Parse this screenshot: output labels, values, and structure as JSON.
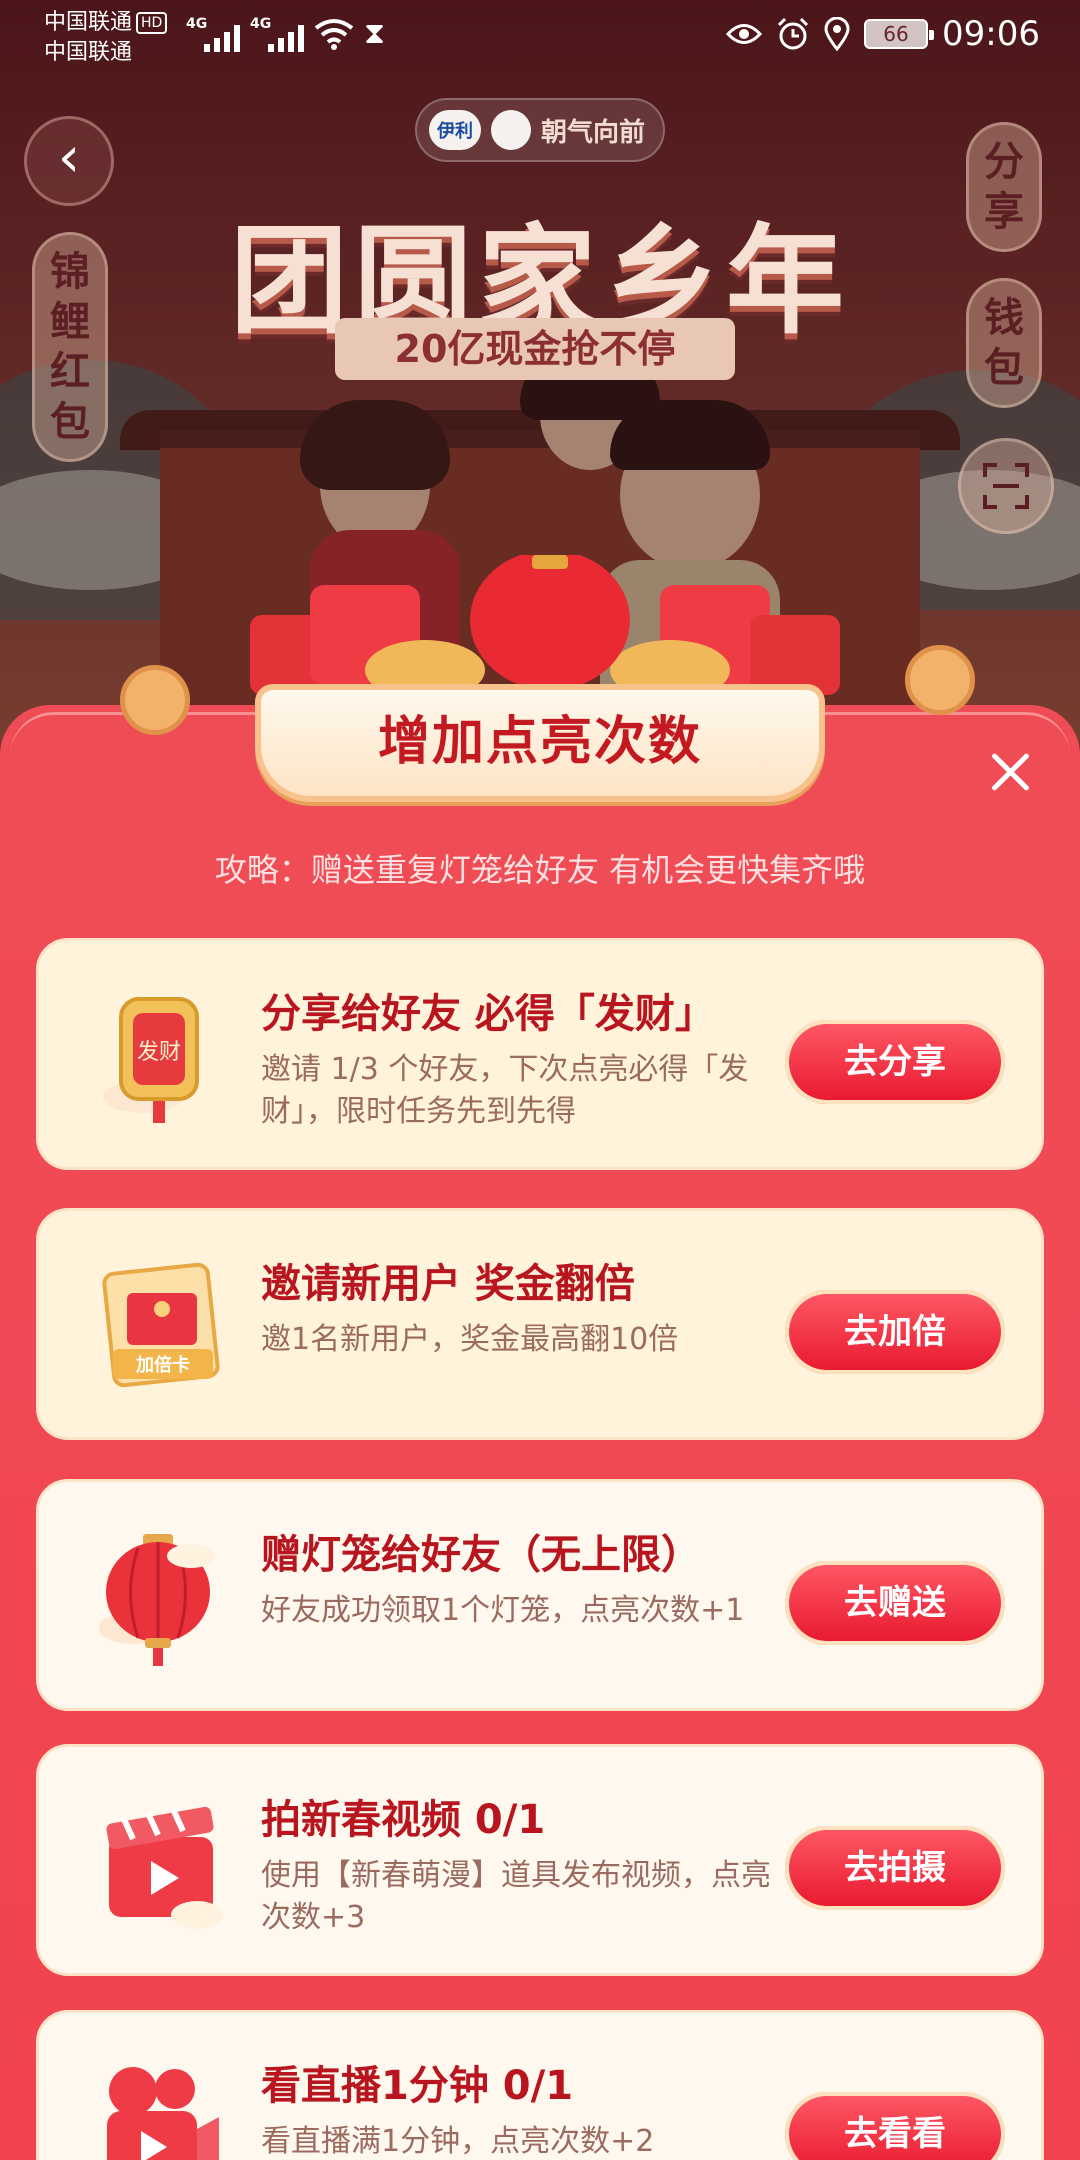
{
  "status_bar": {
    "carrier_1": "中国联通",
    "hd_label": "HD",
    "carrier_2": "中国联通",
    "net_1": "4G",
    "net_2": "4G",
    "battery": "66",
    "time": "09:06"
  },
  "hero": {
    "partner_logo": "伊利",
    "partner_slogan": "朝气向前",
    "title": "团圆家乡年",
    "subtitle": "20亿现金抢不停"
  },
  "side": {
    "left_tag": "锦鲤红包",
    "right_share": "分享",
    "right_wallet": "钱包"
  },
  "sheet": {
    "banner": "增加点亮次数",
    "tip": "攻略：赠送重复灯笼给好友 有机会更快集齐哦"
  },
  "tasks": [
    {
      "title": "分享给好友 必得「发财」",
      "desc": "邀请 1/3 个好友，下次点亮必得「发财」，限时任务先到先得",
      "button": "去分享",
      "icon_text": "发财",
      "icon": "fortune-charm-icon"
    },
    {
      "title": "邀请新用户 奖金翻倍",
      "desc": "邀1名新用户，奖金最高翻10倍",
      "button": "去加倍",
      "icon_text": "加倍卡",
      "icon": "double-card-icon"
    },
    {
      "title": "赠灯笼给好友（无上限）",
      "desc": "好友成功领取1个灯笼，点亮次数+1",
      "button": "去赠送",
      "icon": "lantern-icon"
    },
    {
      "title": "拍新春视频 0/1",
      "desc": "使用【新春萌漫】道具发布视频，点亮次数+3",
      "button": "去拍摄",
      "icon": "clapperboard-icon"
    },
    {
      "title": "看直播1分钟 0/1",
      "desc": "看直播满1分钟，点亮次数+2",
      "button": "去看看",
      "icon": "live-camera-icon"
    }
  ],
  "colors": {
    "sheet": "#f04a55",
    "title_red": "#b8151f",
    "button_red": "#e8172d"
  }
}
